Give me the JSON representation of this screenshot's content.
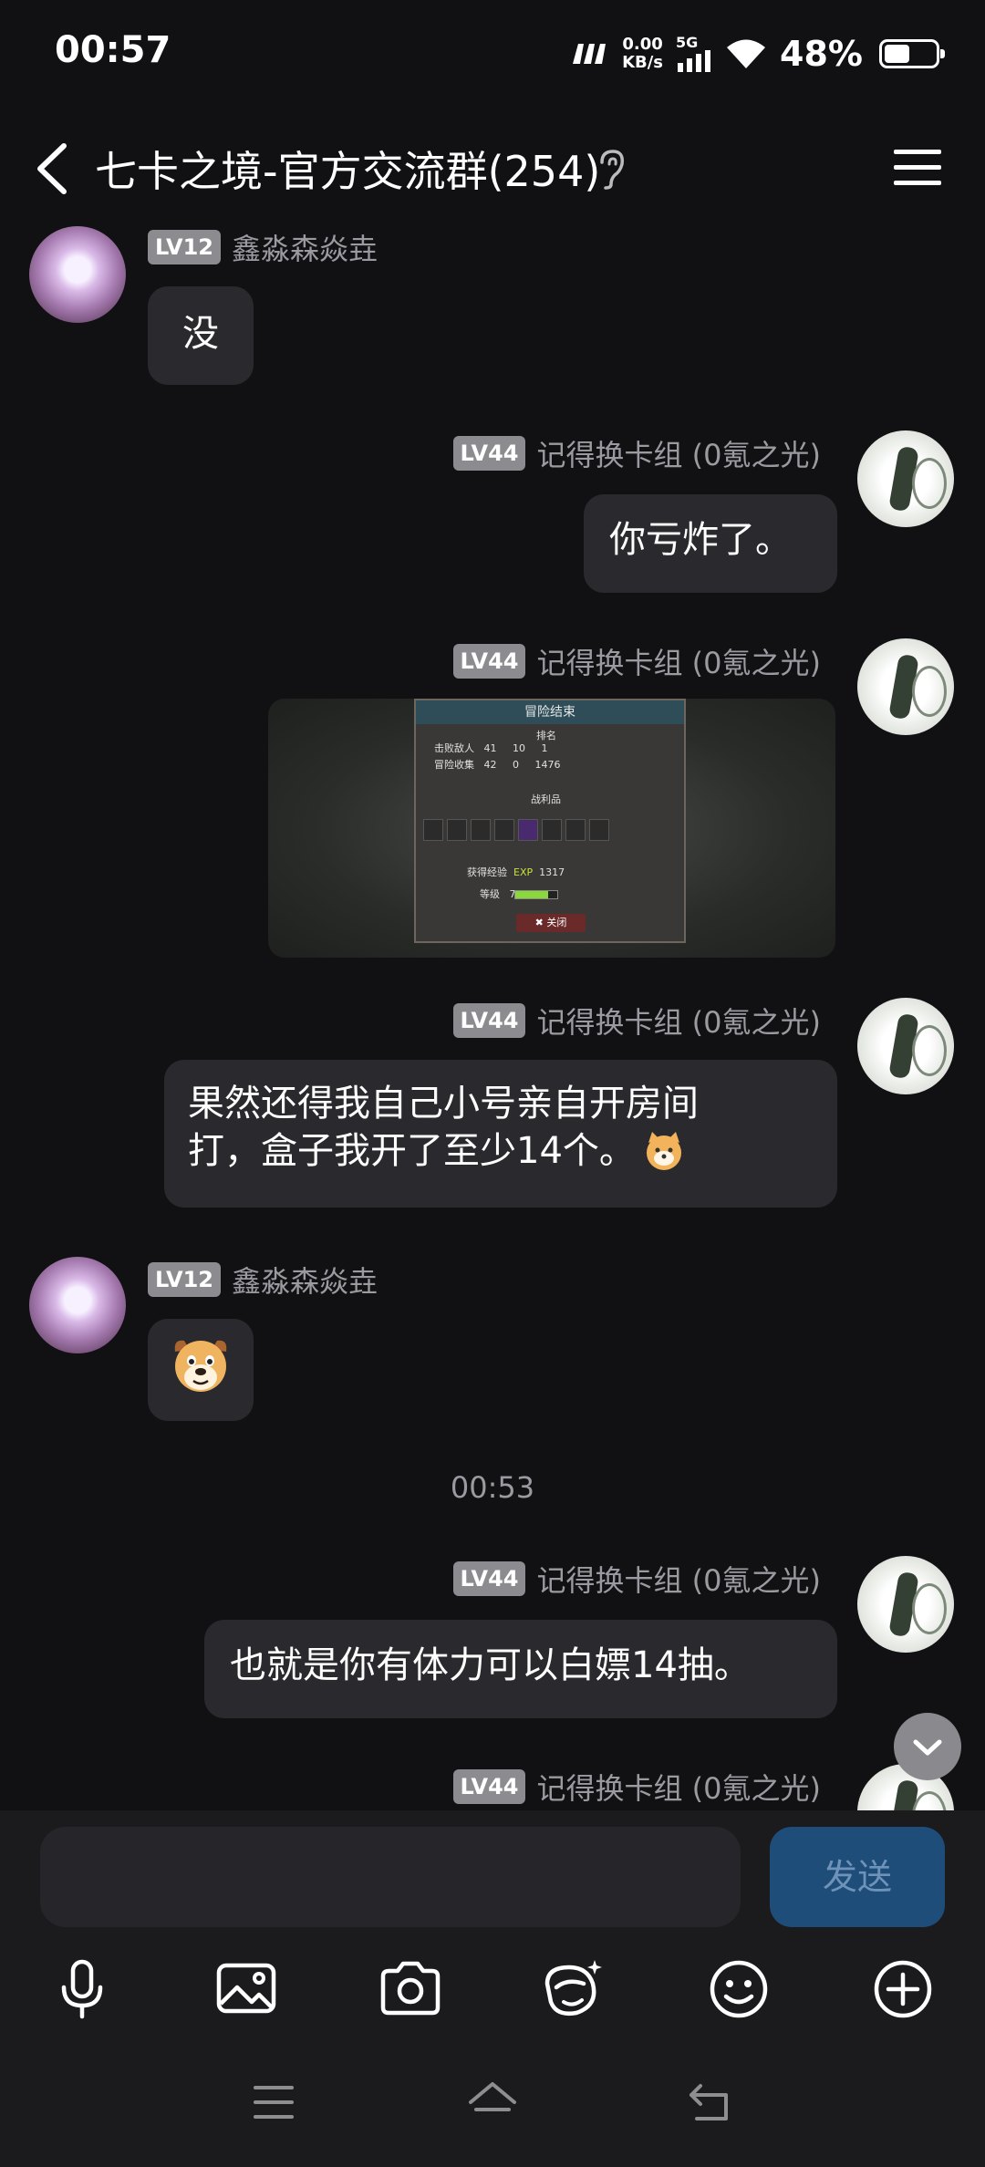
{
  "status_bar": {
    "time": "00:57",
    "net_speed_value": "0.00",
    "net_speed_unit": "KB/s",
    "network": "5G",
    "battery_percent": "48%",
    "battery_level": 0.48
  },
  "header": {
    "title": "七卡之境-官方交流群(254)"
  },
  "messages": [
    {
      "level": "LV12",
      "sender": "鑫淼森焱垚",
      "text": "没"
    },
    {
      "level": "LV44",
      "sender": "记得换卡组 (0氪之光)",
      "text": "你亏炸了。"
    },
    {
      "level": "LV44",
      "sender": "记得换卡组 (0氪之光)",
      "image": {
        "title": "冒险结束",
        "rank_label": "排名",
        "defeated_label": "击败敌人",
        "collect_label": "冒险收集",
        "stats_row1": [
          "41",
          "10",
          "1"
        ],
        "stats_row2": [
          "42",
          "0",
          "1476"
        ],
        "loot_label": "战利品",
        "exp_label": "获得经验",
        "exp_tag": "EXP",
        "exp_value": "1317",
        "level_label": "等级",
        "level_value": "7",
        "close_label": "关闭"
      }
    },
    {
      "level": "LV44",
      "sender": "记得换卡组 (0氪之光)",
      "text_line1": "果然还得我自己小号亲自开房间",
      "text_line2": "打，盒子我开了至少14个。"
    },
    {
      "level": "LV12",
      "sender": "鑫淼森焱垚",
      "emoji": "dog-face-emoji"
    },
    {
      "timestamp": "00:53"
    },
    {
      "level": "LV44",
      "sender": "记得换卡组 (0氪之光)",
      "text": "也就是你有体力可以白嫖14抽。"
    },
    {
      "level": "LV44",
      "sender": "记得换卡组 (0氪之光)"
    }
  ],
  "composer": {
    "placeholder": "",
    "send_label": "发送"
  },
  "toolbar_icons": [
    "microphone-icon",
    "image-icon",
    "camera-icon",
    "gif-face-icon",
    "emoji-icon",
    "plus-icon"
  ],
  "nav_icons": [
    "menu-icon",
    "home-icon",
    "back-icon"
  ],
  "colors": {
    "background": "#111114",
    "bubble": "#2a2a2e",
    "send_button": "#1e4d7a",
    "level_badge": "#8c8c90"
  }
}
